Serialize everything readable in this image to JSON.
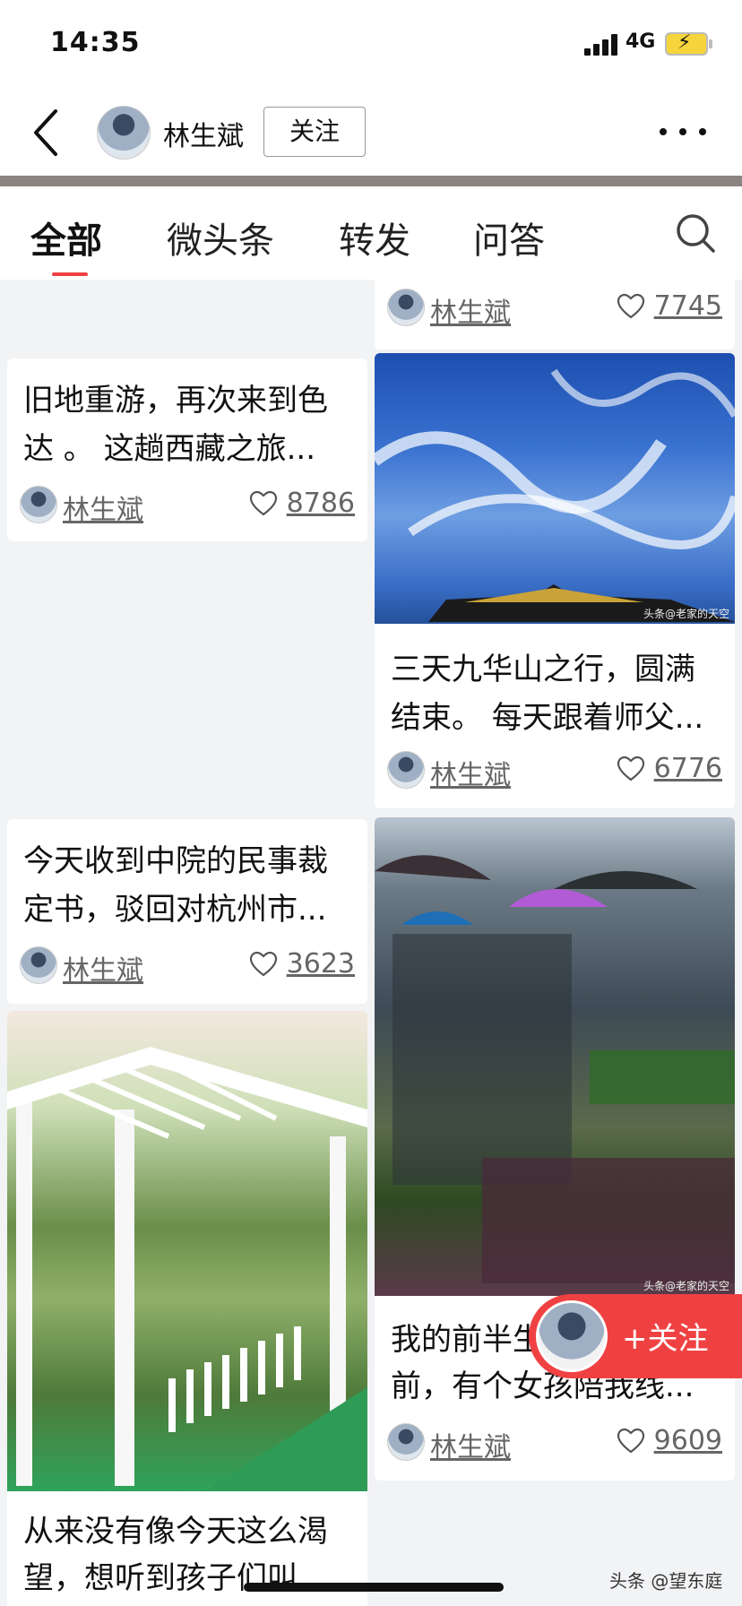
{
  "status_bar": {
    "time": "14:35",
    "network": "4G"
  },
  "header": {
    "author_name": "林生斌",
    "follow_label": "关注"
  },
  "tabs": [
    {
      "label": "全部",
      "active": true
    },
    {
      "label": "微头条",
      "active": false
    },
    {
      "label": "转发",
      "active": false
    },
    {
      "label": "问答",
      "active": false
    }
  ],
  "feed": {
    "top_partial": {
      "author": "林生斌",
      "likes": "7745"
    },
    "posts": [
      {
        "title": "旧地重游，再次来到色达 。 这趟西藏之旅...",
        "author": "林生斌",
        "likes": "8786"
      },
      {
        "title": "三天九华山之行，圆满结束。 每天跟着师父...",
        "author": "林生斌",
        "likes": "6776",
        "watermark": "头条@老家的天空"
      },
      {
        "title": "今天收到中院的民事裁定书，驳回对杭州市...",
        "author": "林生斌",
        "likes": "3623"
      },
      {
        "title": "我的前半生...前，有个女孩陪我线...",
        "title_line1": "我的前半生",
        "title_line2": "前，有个女孩陪我线...",
        "author": "林生斌",
        "likes": "9609",
        "watermark": "头条@老家的天空"
      },
      {
        "title_line1": "从来没有像今天这么渴",
        "title_line2": "望，想听到孩子们叫..."
      }
    ]
  },
  "floating_follow": {
    "label": "+关注"
  },
  "footer_watermark": "头条 @望东庭",
  "colors": {
    "accent": "#f04142",
    "divider": "#8c8480"
  }
}
